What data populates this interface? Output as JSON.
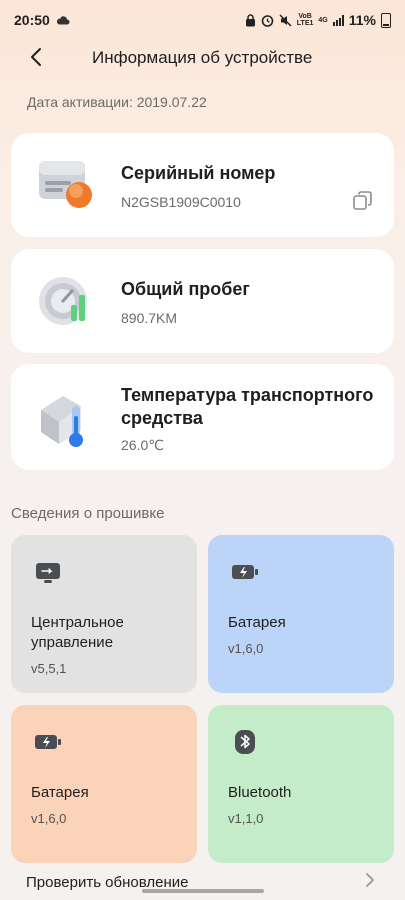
{
  "status_bar": {
    "time": "20:50",
    "network_top": "VoB",
    "network_bottom": "LTE1",
    "network_type": "4G",
    "battery": "11%"
  },
  "header": {
    "title": "Информация об устройстве",
    "activation": "Дата активации: 2019.07.22"
  },
  "cards": [
    {
      "title": "Серийный номер",
      "value": "N2GSB1909C0010",
      "icon": "device-serial-icon"
    },
    {
      "title": "Общий пробег",
      "value": "890.7KM",
      "icon": "speedometer-icon"
    },
    {
      "title": "Температура транспортного средства",
      "value": "26.0℃",
      "icon": "thermometer-icon"
    }
  ],
  "firmware": {
    "section_label": "Сведения о прошивке",
    "tiles": [
      {
        "name": "Центральное управление",
        "version": "v5,5,1",
        "icon": "controller-icon",
        "bg": "#e3e2e2"
      },
      {
        "name": "Батарея",
        "version": "v1,6,0",
        "icon": "battery-icon",
        "bg": "#bcd4f8"
      },
      {
        "name": "Батарея",
        "version": "v1,6,0",
        "icon": "battery-icon",
        "bg": "#fbd3b9"
      },
      {
        "name": "Bluetooth",
        "version": "v1,1,0",
        "icon": "bluetooth-icon",
        "bg": "#c4ecc8"
      }
    ]
  },
  "footer": {
    "check_update": "Проверить обновление"
  },
  "colors": {
    "accent_orange": "#f07a2a",
    "accent_green": "#5dd27a",
    "accent_blue": "#2f7bea"
  }
}
